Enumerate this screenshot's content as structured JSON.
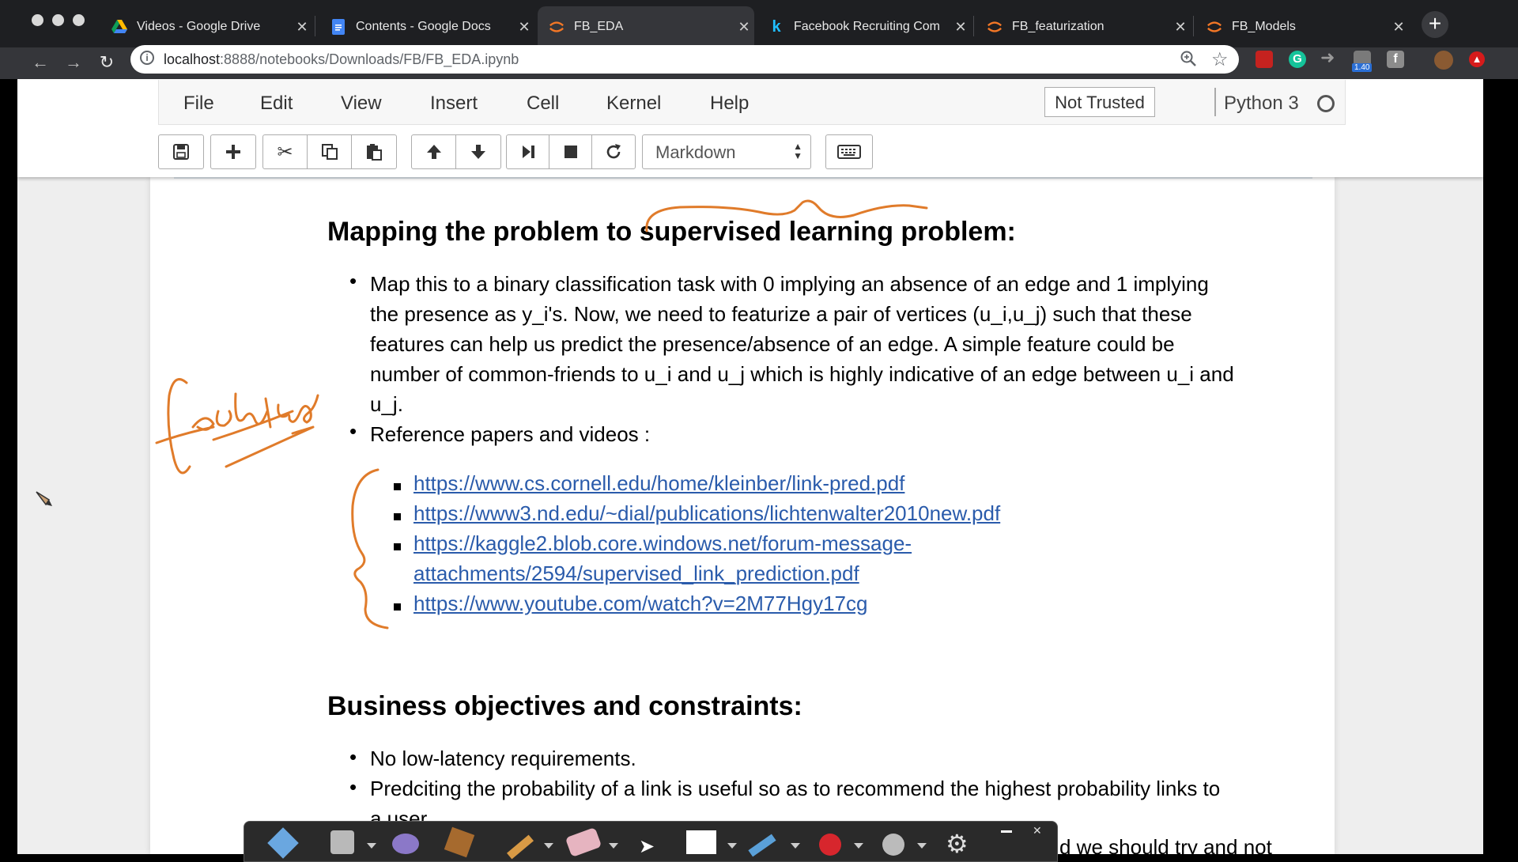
{
  "browser": {
    "tabs": [
      {
        "label": "Videos - Google Drive",
        "icon": "google-drive-icon"
      },
      {
        "label": "Contents - Google Docs",
        "icon": "google-docs-icon"
      },
      {
        "label": "FB_EDA",
        "icon": "jupyter-icon"
      },
      {
        "label": "Facebook Recruiting Com",
        "icon": "kaggle-icon"
      },
      {
        "label": "FB_featurization",
        "icon": "jupyter-icon"
      },
      {
        "label": "FB_Models",
        "icon": "jupyter-icon"
      }
    ],
    "active_tab": 2,
    "close_glyph": "✕",
    "new_tab_glyph": "+",
    "url_host": "localhost",
    "url_path": ":8888/notebooks/Downloads/FB/FB_EDA.ipynb",
    "badge_count": "1.40"
  },
  "jupyter": {
    "menu": [
      "File",
      "Edit",
      "View",
      "Insert",
      "Cell",
      "Kernel",
      "Help"
    ],
    "trust": "Not Trusted",
    "kernel": "Python 3",
    "cell_type": "Markdown"
  },
  "notebook": {
    "heading1": "Mapping the problem to supervised learning problem:",
    "para_lines": [
      "Map this to a binary classification task with 0 implying an absence of an edge and 1 implying",
      "the presence as y_i's. Now, we need to featurize a pair of vertices (u_i,u_j) such that these",
      "features can help us predict the presence/absence of an edge. A simple feature could be",
      "number of common-friends to u_i and u_j which is highly indicative of an edge between u_i and",
      "u_j."
    ],
    "ref_bullet": "Reference papers and videos :",
    "links": [
      "https://www.cs.cornell.edu/home/kleinber/link-pred.pdf",
      "https://www3.nd.edu/~dial/publications/lichtenwalter2010new.pdf",
      "https://kaggle2.blob.core.windows.net/forum-message-",
      "attachments/2594/supervised_link_prediction.pdf",
      "https://www.youtube.com/watch?v=2M77Hgy17cg"
    ],
    "heading2": "Business objectives and constraints:",
    "obj_1": "No low-latency requirements.",
    "obj_2": "Predciting the probability of a link is useful so as to recommend the highest probability links to",
    "obj_2_cont": "a user.",
    "obj_3_partial": "d we should try and not"
  },
  "annotations": {
    "handwritten_word": "feature",
    "ink_color": "#e07b2a"
  }
}
